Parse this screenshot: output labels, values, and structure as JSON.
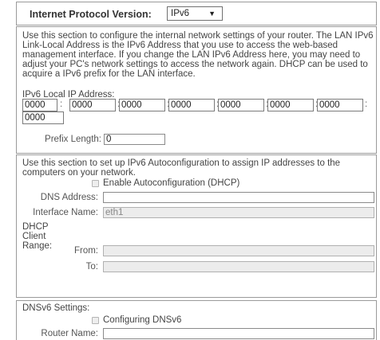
{
  "protocol": {
    "label": "Internet Protocol Version:",
    "selected": "IPv6"
  },
  "lan": {
    "description": "Use this section to configure the internal network settings of your router. The LAN IPv6 Link-Local Address is the IPv6 Address that you use to access the web-based management interface. If you change the LAN IPv6 Address here, you may need to adjust your PC's network settings to access the network again. DHCP can be used to acquire a IPv6 prefix for the LAN interface.",
    "local_ip_label": "IPv6 Local IP Address:",
    "segments": [
      "0000",
      "0000",
      "0000",
      "0000",
      "0000",
      "0000",
      "0000",
      "0000"
    ],
    "prefix_label": "Prefix Length:",
    "prefix_value": "0"
  },
  "autoconfig": {
    "description": "Use this section to set up IPv6 Autoconfiguration to assign IP addresses to the computers on your network.",
    "enable_label": "Enable Autoconfiguration (DHCP)",
    "dns_label": "DNS Address:",
    "dns_value": "",
    "interface_label": "Interface Name:",
    "interface_value": "eth1",
    "range_label": "DHCP Client Range:",
    "from_label": "From:",
    "from_value": "",
    "to_label": "To:",
    "to_value": ""
  },
  "dnsv6": {
    "settings_label": "DNSv6 Settings:",
    "configuring_label": "Configuring DNSv6",
    "router_label": "Router Name:",
    "router_value": ""
  }
}
